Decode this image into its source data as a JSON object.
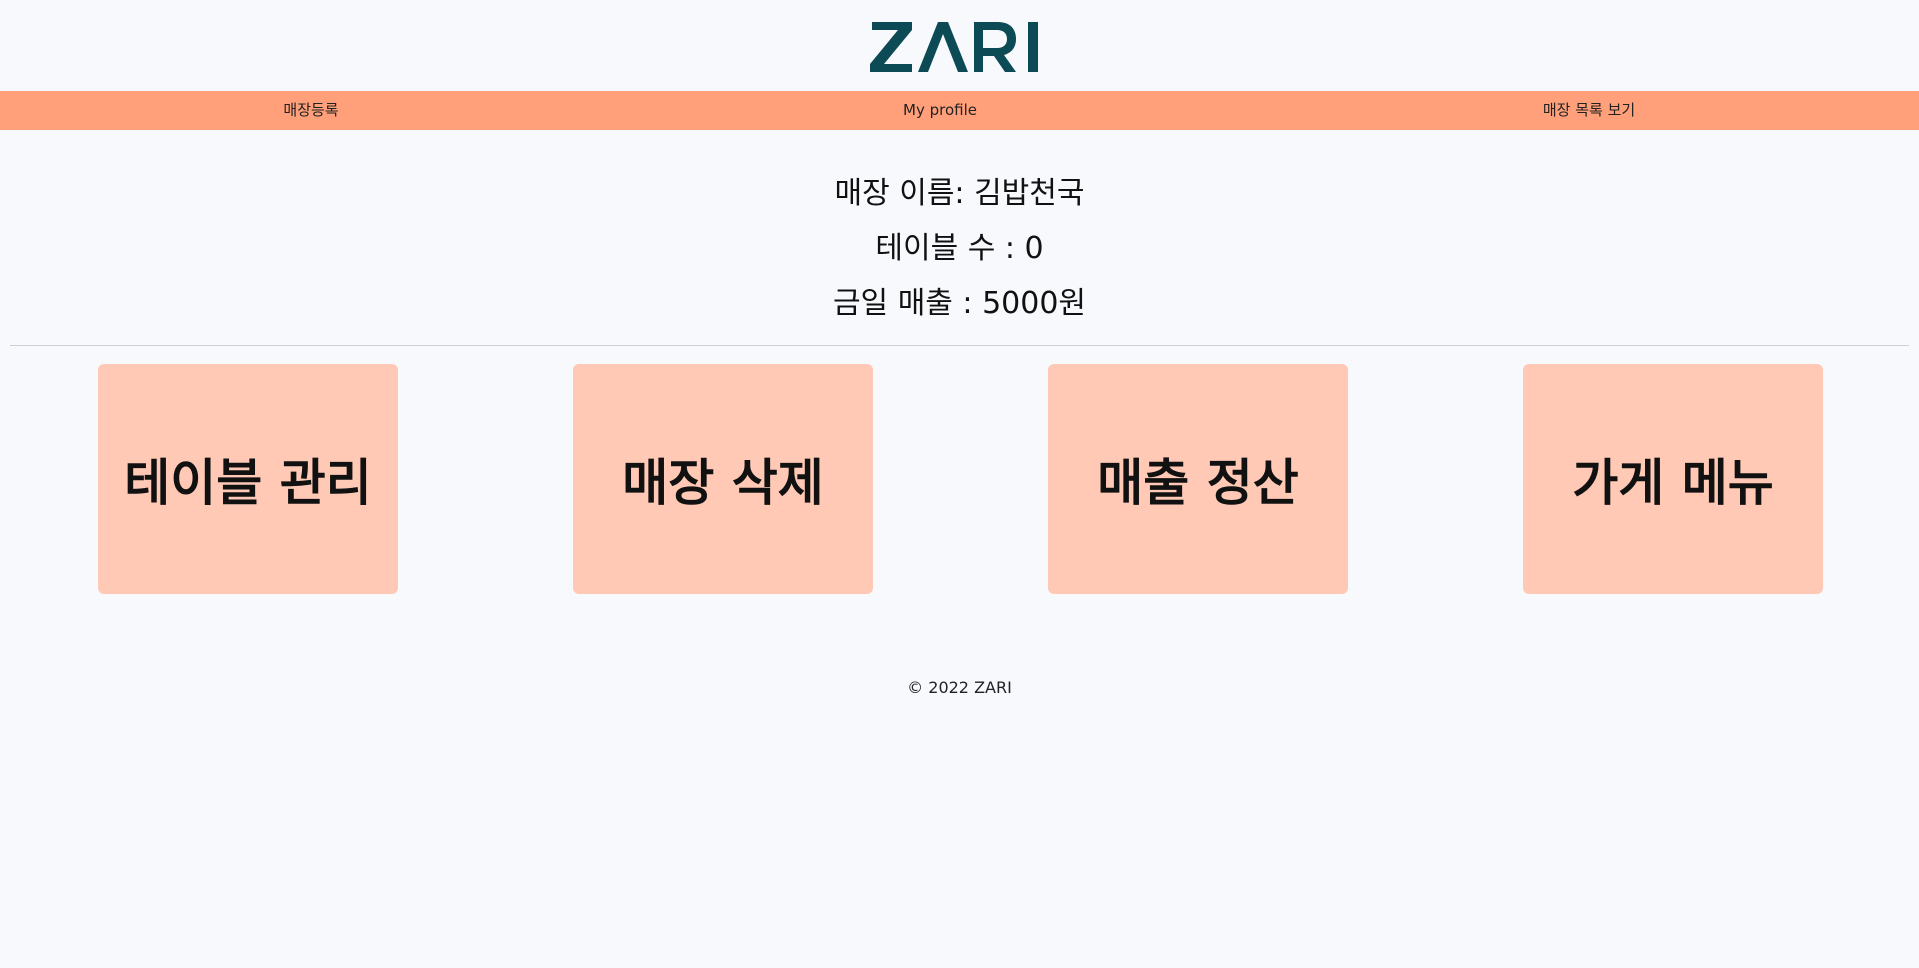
{
  "brand": {
    "logo_text": "ZARI",
    "logo_color": "#0c4a55"
  },
  "nav": {
    "items": [
      {
        "label": "매장등록"
      },
      {
        "label": "My profile"
      },
      {
        "label": "매장 목록 보기"
      }
    ],
    "background": "#ffa07a"
  },
  "store": {
    "name_line": "매장 이름: 김밥천국",
    "tables_line": "테이블 수 : 0",
    "sales_line": "금일 매출 : 5000원"
  },
  "cards": [
    {
      "label": "테이블 관리"
    },
    {
      "label": "매장 삭제"
    },
    {
      "label": "매출 정산"
    },
    {
      "label": "가게 메뉴"
    }
  ],
  "card_color": "#ffc9b6",
  "footer": {
    "text": "© 2022 ZARI"
  }
}
